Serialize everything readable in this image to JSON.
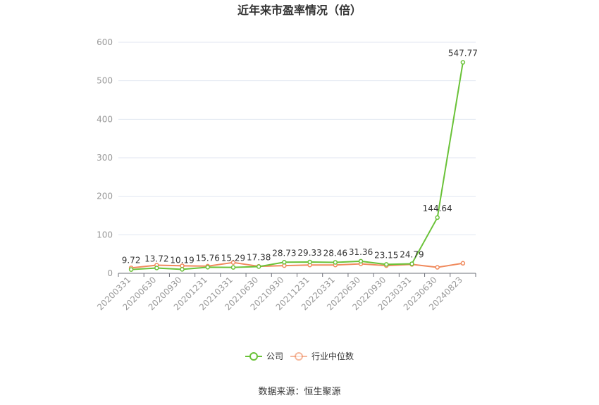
{
  "chart_data": {
    "type": "line",
    "title": "近年来市盈率情况（倍）",
    "categories": [
      "20200331",
      "20200630",
      "20200930",
      "20201231",
      "20210331",
      "20210630",
      "20210930",
      "20211231",
      "20220331",
      "20220630",
      "20220930",
      "20230331",
      "20230630",
      "20240823"
    ],
    "ylim": [
      0,
      600
    ],
    "yticks": [
      0,
      100,
      200,
      300,
      400,
      500,
      600
    ],
    "grid": true,
    "legend_position": "bottom",
    "series": [
      {
        "name": "公司",
        "color": "#6ac238",
        "values": [
          9.72,
          13.72,
          10.19,
          15.76,
          15.29,
          17.38,
          28.73,
          29.33,
          28.46,
          31.36,
          23.15,
          24.79,
          144.64,
          547.77
        ],
        "labels": [
          "9.72",
          "13.72",
          "10.19",
          "15.76",
          "15.29",
          "17.38",
          "28.73",
          "29.33",
          "28.46",
          "31.36",
          "23.15",
          "24.79",
          "144.64",
          "547.77"
        ]
      },
      {
        "name": "行业中位数",
        "color": "#f08a5d",
        "values": [
          14,
          21,
          19.5,
          18.5,
          28,
          18,
          20,
          21.5,
          21.5,
          24.5,
          20,
          23,
          15.5,
          26
        ]
      }
    ]
  },
  "source_text": "数据来源：恒生聚源"
}
